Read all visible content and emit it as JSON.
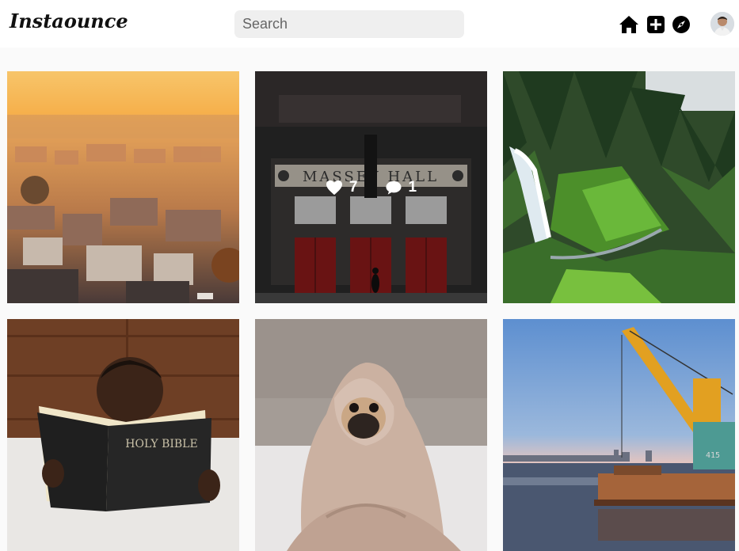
{
  "app": {
    "logo_text": "Instaounce"
  },
  "search": {
    "placeholder": "Search"
  },
  "nav": {
    "icons": [
      "home-icon",
      "add-post-icon",
      "explore-icon"
    ]
  },
  "posts": [
    {
      "name": "post-city-sunset"
    },
    {
      "name": "post-massey-hall",
      "sign_text": "MASSEY HALL",
      "likes": "7",
      "comments": "1"
    },
    {
      "name": "post-waterfall"
    },
    {
      "name": "post-boy-reading-bible",
      "book_text": "HOLY BIBLE"
    },
    {
      "name": "post-pug-blanket"
    },
    {
      "name": "post-crane-barge",
      "container_text": "415"
    }
  ],
  "colors": {
    "accent": "#000000",
    "search_bg": "#efefef",
    "page_bg": "#fafafa"
  }
}
